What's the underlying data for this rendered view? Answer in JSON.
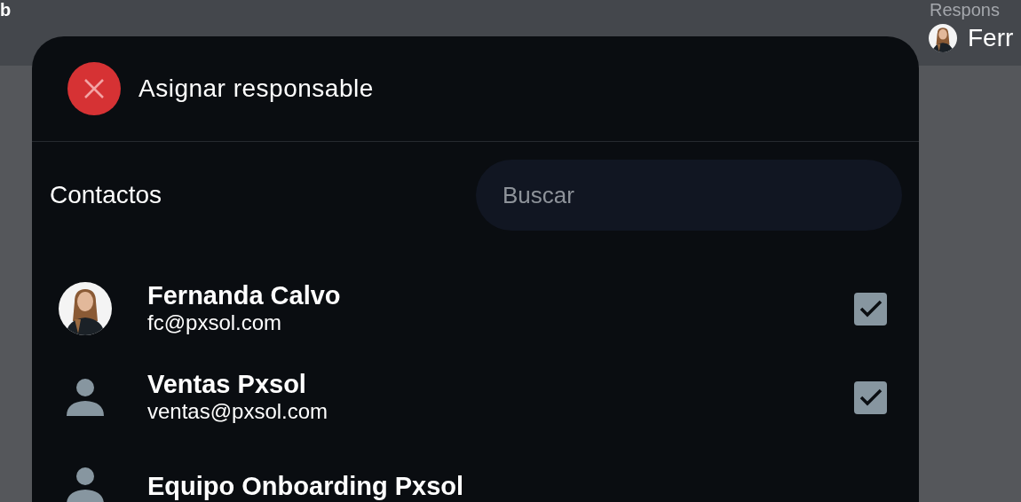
{
  "background": {
    "page_title": "b",
    "column_label": "Respons",
    "assignee": {
      "name": "Ferr"
    }
  },
  "dialog": {
    "title": "Asignar responsable",
    "section_label": "Contactos",
    "search": {
      "placeholder": "Buscar"
    },
    "contacts": [
      {
        "name": "Fernanda Calvo",
        "email": "fc@pxsol.com",
        "checked": true
      },
      {
        "name": "Ventas Pxsol",
        "email": "ventas@pxsol.com",
        "kind": "generic",
        "checked": true
      },
      {
        "name": "Equipo Onboarding Pxsol",
        "kind": "generic"
      }
    ]
  }
}
